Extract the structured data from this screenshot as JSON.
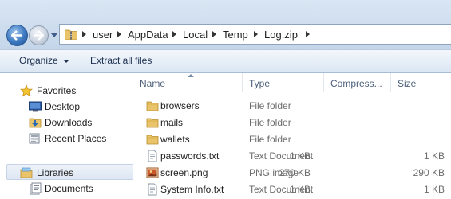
{
  "address": {
    "crumbs": [
      "user",
      "AppData",
      "Local",
      "Temp",
      "Log.zip"
    ]
  },
  "toolbar": {
    "organize_label": "Organize",
    "extract_label": "Extract all files"
  },
  "navpane": {
    "favorites_label": "Favorites",
    "items": [
      {
        "label": "Desktop",
        "icon": "desktop-icon"
      },
      {
        "label": "Downloads",
        "icon": "downloads-icon"
      },
      {
        "label": "Recent Places",
        "icon": "recent-places-icon"
      }
    ],
    "libraries_label": "Libraries",
    "library_items": [
      {
        "label": "Documents",
        "icon": "documents-icon"
      }
    ]
  },
  "columns": {
    "name": "Name",
    "type": "Type",
    "compressed": "Compress...",
    "size": "Size"
  },
  "files": [
    {
      "name": "browsers",
      "type": "File folder",
      "compressed": "",
      "size": "",
      "icon": "folder-icon"
    },
    {
      "name": "mails",
      "type": "File folder",
      "compressed": "",
      "size": "",
      "icon": "folder-icon"
    },
    {
      "name": "wallets",
      "type": "File folder",
      "compressed": "",
      "size": "",
      "icon": "folder-icon"
    },
    {
      "name": "passwords.txt",
      "type": "Text Document",
      "compressed": "1 KB",
      "size": "1 KB",
      "icon": "text-file-icon"
    },
    {
      "name": "screen.png",
      "type": "PNG image",
      "compressed": "270 KB",
      "size": "290 KB",
      "icon": "image-file-icon"
    },
    {
      "name": "System Info.txt",
      "type": "Text Document",
      "compressed": "1 KB",
      "size": "1 KB",
      "icon": "text-file-icon"
    }
  ]
}
